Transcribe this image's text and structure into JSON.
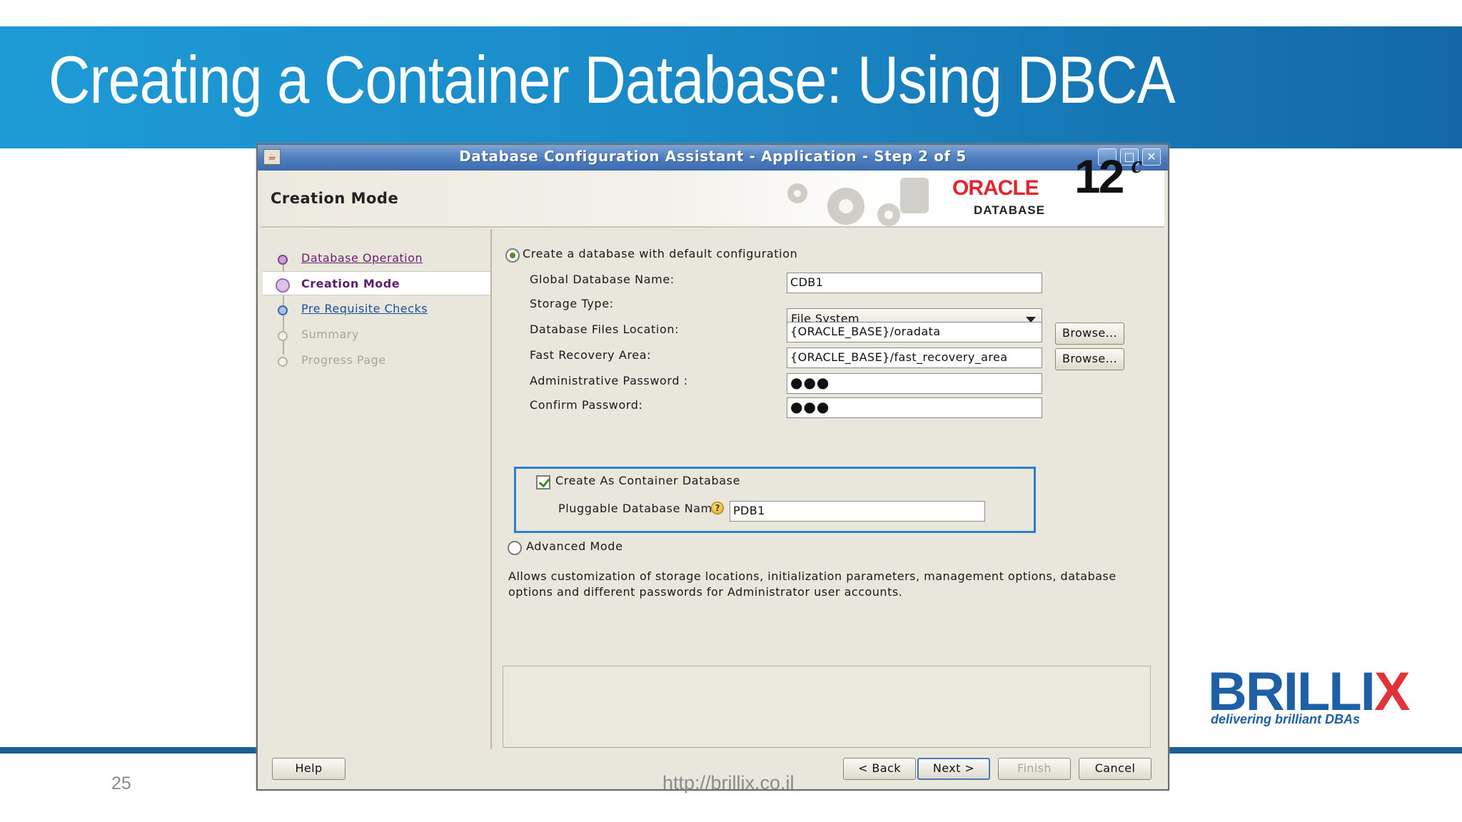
{
  "slide": {
    "title": "Creating a Container Database: Using DBCA",
    "number": "25",
    "footer_url": "http://brillix.co.il",
    "brand": {
      "name_main": "BRILLI",
      "name_x": "X",
      "tagline": "delivering brilliant DBAs"
    }
  },
  "window": {
    "title": "Database Configuration Assistant - Application - Step 2 of 5",
    "controls": {
      "minimize": "_",
      "maximize": "□",
      "close": "✕"
    },
    "icon": "java-cup-icon"
  },
  "header": {
    "page_heading": "Creation Mode",
    "oracle_word": "ORACLE",
    "oracle_product": "DATABASE",
    "version": "12",
    "version_sup": "c"
  },
  "nav": {
    "steps": [
      {
        "label": "Database Operation",
        "state": "visited"
      },
      {
        "label": "Creation Mode",
        "state": "current"
      },
      {
        "label": "Pre Requisite Checks",
        "state": "next"
      },
      {
        "label": "Summary",
        "state": "disabled"
      },
      {
        "label": "Progress Page",
        "state": "disabled"
      }
    ]
  },
  "form": {
    "default_config_radio": "Create a database with default configuration",
    "global_db_name": {
      "label": "Global Database Name:",
      "value": "CDB1"
    },
    "storage_type": {
      "label": "Storage Type:",
      "value": "File System"
    },
    "db_files_location": {
      "label": "Database Files Location:",
      "value": "{ORACLE_BASE}/oradata",
      "browse": "Browse..."
    },
    "fast_recovery_area": {
      "label": "Fast Recovery Area:",
      "value": "{ORACLE_BASE}/fast_recovery_area",
      "browse": "Browse..."
    },
    "admin_password": {
      "label": "Administrative Password :",
      "value": "●●●"
    },
    "confirm_password": {
      "label": "Confirm Password:",
      "value": "●●●"
    },
    "container_checkbox": "Create As Container Database",
    "pluggable_db_name": {
      "label": "Pluggable Database Name",
      "value": "PDB1"
    },
    "advanced_radio": "Advanced Mode",
    "advanced_desc": "Allows customization of storage locations, initialization parameters, management options, database options and different passwords for Administrator user accounts."
  },
  "buttons": {
    "help": "Help",
    "back": "< Back",
    "next": "Next >",
    "finish": "Finish",
    "cancel": "Cancel"
  },
  "colors": {
    "title_band": "#1e9bd6",
    "titlebar": "#4f7fc0",
    "highlight_box": "#2f7fd0",
    "oracle_red": "#e3262e",
    "brillix_blue": "#1f5fa5",
    "brillix_red": "#e0343a"
  }
}
